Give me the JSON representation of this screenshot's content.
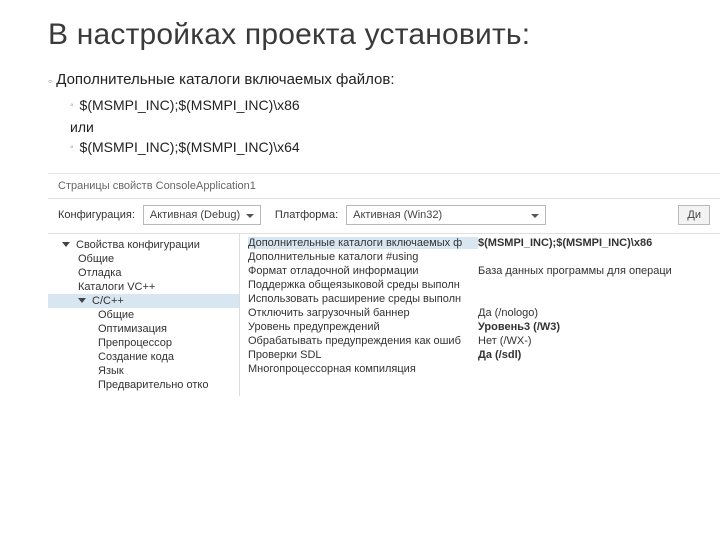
{
  "title": "В настройках проекта установить:",
  "bullet1": "Дополнительные каталоги включаемых файлов:",
  "bullet2a": "$(MSMPI_INC);$(MSMPI_INC)\\x86",
  "or": "или",
  "bullet2b": "$(MSMPI_INC);$(MSMPI_INC)\\x64",
  "dialog": {
    "window_title": "Страницы свойств ConsoleApplication1",
    "config_label": "Конфигурация:",
    "config_value": "Активная (Debug)",
    "platform_label": "Платформа:",
    "platform_value": "Активная (Win32)",
    "manager_btn": "Ди"
  },
  "tree": {
    "root": "Свойства конфигурации",
    "items": [
      "Общие",
      "Отладка",
      "Каталоги VC++"
    ],
    "cpp": "C/C++",
    "cpp_items": [
      "Общие",
      "Оптимизация",
      "Препроцессор",
      "Создание кода",
      "Язык",
      "Предварительно отко"
    ]
  },
  "grid": [
    {
      "k": "Дополнительные каталоги включаемых ф",
      "v": "$(MSMPI_INC);$(MSMPI_INC)\\x86",
      "sel": true,
      "bold": true
    },
    {
      "k": "Дополнительные каталоги #using",
      "v": ""
    },
    {
      "k": "Формат отладочной информации",
      "v": "База данных программы для операци"
    },
    {
      "k": "Поддержка общеязыковой среды выполн",
      "v": ""
    },
    {
      "k": "Использовать расширение среды выполн",
      "v": ""
    },
    {
      "k": "Отключить загрузочный баннер",
      "v": "Да (/nologo)"
    },
    {
      "k": "Уровень предупреждений",
      "v": "Уровень3 (/W3)",
      "bold": true
    },
    {
      "k": "Обрабатывать предупреждения как ошиб",
      "v": "Нет (/WX-)"
    },
    {
      "k": "Проверки SDL",
      "v": "Да (/sdl)",
      "bold": true
    },
    {
      "k": "Многопроцессорная компиляция",
      "v": ""
    }
  ]
}
